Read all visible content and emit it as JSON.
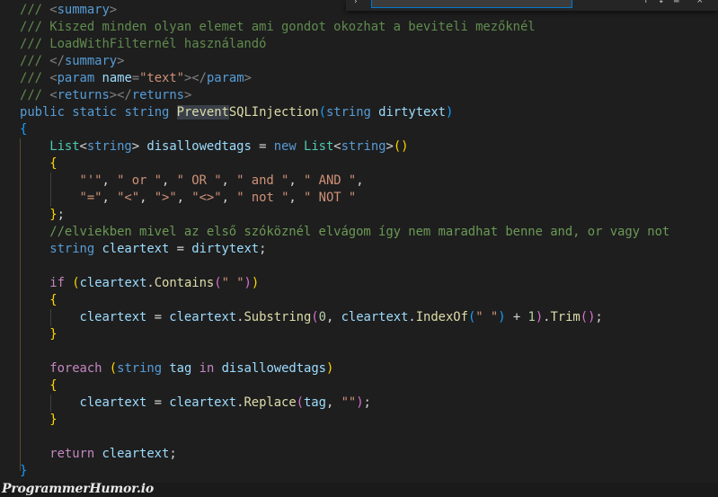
{
  "editor": {
    "language": "csharp",
    "find_widget": {
      "search_value": "",
      "match_count": "",
      "toggle_icon": "chevron-right-icon",
      "icons": [
        "arrow-up-icon",
        "arrow-down-icon",
        "selection-icon",
        "close-icon"
      ]
    },
    "current_line": 7,
    "selected_text": "Prevent",
    "lines": [
      {
        "n": 1,
        "tokens": [
          [
            "doc",
            "/// "
          ],
          [
            "xmlp",
            "<"
          ],
          [
            "xmltag",
            "summary"
          ],
          [
            "xmlp",
            ">"
          ]
        ]
      },
      {
        "n": 2,
        "tokens": [
          [
            "doc",
            "/// Kiszed minden olyan elemet ami gondot okozhat a beviteli mezőknél"
          ]
        ]
      },
      {
        "n": 3,
        "tokens": [
          [
            "doc",
            "/// LoadWithFilternél használandó"
          ]
        ]
      },
      {
        "n": 4,
        "tokens": [
          [
            "doc",
            "/// "
          ],
          [
            "xmlp",
            "</"
          ],
          [
            "xmltag",
            "summary"
          ],
          [
            "xmlp",
            ">"
          ]
        ]
      },
      {
        "n": 5,
        "tokens": [
          [
            "doc",
            "/// "
          ],
          [
            "xmlp",
            "<"
          ],
          [
            "xmltag",
            "param"
          ],
          [
            "plain",
            " "
          ],
          [
            "var",
            "name"
          ],
          [
            "xmlp",
            "="
          ],
          [
            "str",
            "\"text\""
          ],
          [
            "xmlp",
            "></"
          ],
          [
            "xmltag",
            "param"
          ],
          [
            "xmlp",
            ">"
          ]
        ]
      },
      {
        "n": 6,
        "tokens": [
          [
            "doc",
            "/// "
          ],
          [
            "xmlp",
            "<"
          ],
          [
            "xmltag",
            "returns"
          ],
          [
            "xmlp",
            "></"
          ],
          [
            "xmltag",
            "returns"
          ],
          [
            "xmlp",
            ">"
          ]
        ]
      },
      {
        "n": 7,
        "tokens": [
          [
            "kw",
            "public"
          ],
          [
            "plain",
            " "
          ],
          [
            "kw",
            "static"
          ],
          [
            "plain",
            " "
          ],
          [
            "kw",
            "string"
          ],
          [
            "plain",
            " "
          ],
          [
            "fn sel",
            "Prevent"
          ],
          [
            "fn",
            "SQLInjection"
          ],
          [
            "br3",
            "("
          ],
          [
            "kw",
            "string"
          ],
          [
            "plain",
            " "
          ],
          [
            "var",
            "dirtytext"
          ],
          [
            "br3",
            ")"
          ]
        ]
      },
      {
        "n": 8,
        "tokens": [
          [
            "br3",
            "{"
          ]
        ]
      },
      {
        "n": 9,
        "tokens": [
          [
            "plain",
            "    "
          ],
          [
            "type",
            "List"
          ],
          [
            "plain",
            "<"
          ],
          [
            "kw",
            "string"
          ],
          [
            "plain",
            "> "
          ],
          [
            "var",
            "disallowedtags"
          ],
          [
            "plain",
            " = "
          ],
          [
            "kw",
            "new"
          ],
          [
            "plain",
            " "
          ],
          [
            "type",
            "List"
          ],
          [
            "plain",
            "<"
          ],
          [
            "kw",
            "string"
          ],
          [
            "plain",
            ">"
          ],
          [
            "br1",
            "()"
          ]
        ]
      },
      {
        "n": 10,
        "tokens": [
          [
            "plain",
            "    "
          ],
          [
            "br1",
            "{"
          ]
        ]
      },
      {
        "n": 11,
        "tokens": [
          [
            "plain",
            "        "
          ],
          [
            "str",
            "\"'\""
          ],
          [
            "plain",
            ", "
          ],
          [
            "str",
            "\" or \""
          ],
          [
            "plain",
            ", "
          ],
          [
            "str",
            "\" OR \""
          ],
          [
            "plain",
            ", "
          ],
          [
            "str",
            "\" and \""
          ],
          [
            "plain",
            ", "
          ],
          [
            "str",
            "\" AND \""
          ],
          [
            "plain",
            ","
          ]
        ]
      },
      {
        "n": 12,
        "tokens": [
          [
            "plain",
            "        "
          ],
          [
            "str",
            "\"=\""
          ],
          [
            "plain",
            ", "
          ],
          [
            "str",
            "\"<\""
          ],
          [
            "plain",
            ", "
          ],
          [
            "str",
            "\">\""
          ],
          [
            "plain",
            ", "
          ],
          [
            "str",
            "\"<>\""
          ],
          [
            "plain",
            ", "
          ],
          [
            "str",
            "\" not \""
          ],
          [
            "plain",
            ", "
          ],
          [
            "str",
            "\" NOT \""
          ]
        ]
      },
      {
        "n": 13,
        "tokens": [
          [
            "plain",
            "    "
          ],
          [
            "br1",
            "}"
          ],
          [
            "plain",
            ";"
          ]
        ]
      },
      {
        "n": 14,
        "tokens": [
          [
            "plain",
            "    "
          ],
          [
            "cmt",
            "//elviekben mivel az első szóköznél elvágom így nem maradhat benne and, or vagy not"
          ]
        ]
      },
      {
        "n": 15,
        "tokens": [
          [
            "plain",
            "    "
          ],
          [
            "kw",
            "string"
          ],
          [
            "plain",
            " "
          ],
          [
            "var",
            "cleartext"
          ],
          [
            "plain",
            " = "
          ],
          [
            "var",
            "dirtytext"
          ],
          [
            "plain",
            ";"
          ]
        ]
      },
      {
        "n": 16,
        "tokens": []
      },
      {
        "n": 17,
        "tokens": [
          [
            "plain",
            "    "
          ],
          [
            "ctl",
            "if"
          ],
          [
            "plain",
            " "
          ],
          [
            "br1",
            "("
          ],
          [
            "var",
            "cleartext"
          ],
          [
            "plain",
            "."
          ],
          [
            "fn",
            "Contains"
          ],
          [
            "br2",
            "("
          ],
          [
            "str",
            "\" \""
          ],
          [
            "br2",
            ")"
          ],
          [
            "br1",
            ")"
          ]
        ]
      },
      {
        "n": 18,
        "tokens": [
          [
            "plain",
            "    "
          ],
          [
            "br1",
            "{"
          ]
        ]
      },
      {
        "n": 19,
        "tokens": [
          [
            "plain",
            "        "
          ],
          [
            "var",
            "cleartext"
          ],
          [
            "plain",
            " = "
          ],
          [
            "var",
            "cleartext"
          ],
          [
            "plain",
            "."
          ],
          [
            "fn",
            "Substring"
          ],
          [
            "br2",
            "("
          ],
          [
            "num",
            "0"
          ],
          [
            "plain",
            ", "
          ],
          [
            "var",
            "cleartext"
          ],
          [
            "plain",
            "."
          ],
          [
            "fn",
            "IndexOf"
          ],
          [
            "br3",
            "("
          ],
          [
            "str",
            "\" \""
          ],
          [
            "br3",
            ")"
          ],
          [
            "plain",
            " + "
          ],
          [
            "num",
            "1"
          ],
          [
            "br2",
            ")"
          ],
          [
            "plain",
            "."
          ],
          [
            "fn",
            "Trim"
          ],
          [
            "br2",
            "()"
          ],
          [
            "plain",
            ";"
          ]
        ]
      },
      {
        "n": 20,
        "tokens": [
          [
            "plain",
            "    "
          ],
          [
            "br1",
            "}"
          ]
        ]
      },
      {
        "n": 21,
        "tokens": []
      },
      {
        "n": 22,
        "tokens": [
          [
            "plain",
            "    "
          ],
          [
            "ctl",
            "foreach"
          ],
          [
            "plain",
            " "
          ],
          [
            "br1",
            "("
          ],
          [
            "kw",
            "string"
          ],
          [
            "plain",
            " "
          ],
          [
            "var",
            "tag"
          ],
          [
            "plain",
            " "
          ],
          [
            "ctl",
            "in"
          ],
          [
            "plain",
            " "
          ],
          [
            "var",
            "disallowedtags"
          ],
          [
            "br1",
            ")"
          ]
        ]
      },
      {
        "n": 23,
        "tokens": [
          [
            "plain",
            "    "
          ],
          [
            "br1",
            "{"
          ]
        ]
      },
      {
        "n": 24,
        "tokens": [
          [
            "plain",
            "        "
          ],
          [
            "var",
            "cleartext"
          ],
          [
            "plain",
            " = "
          ],
          [
            "var",
            "cleartext"
          ],
          [
            "plain",
            "."
          ],
          [
            "fn",
            "Replace"
          ],
          [
            "br2",
            "("
          ],
          [
            "var",
            "tag"
          ],
          [
            "plain",
            ", "
          ],
          [
            "str",
            "\"\""
          ],
          [
            "br2",
            ")"
          ],
          [
            "plain",
            ";"
          ]
        ]
      },
      {
        "n": 25,
        "tokens": [
          [
            "plain",
            "    "
          ],
          [
            "br1",
            "}"
          ]
        ]
      },
      {
        "n": 26,
        "tokens": []
      },
      {
        "n": 27,
        "tokens": [
          [
            "plain",
            "    "
          ],
          [
            "ctl",
            "return"
          ],
          [
            "plain",
            " "
          ],
          [
            "var",
            "cleartext"
          ],
          [
            "plain",
            ";"
          ]
        ]
      },
      {
        "n": 28,
        "tokens": [
          [
            "br3",
            "}"
          ]
        ]
      }
    ]
  },
  "watermark": {
    "text": "ProgrammerHumor.io"
  }
}
